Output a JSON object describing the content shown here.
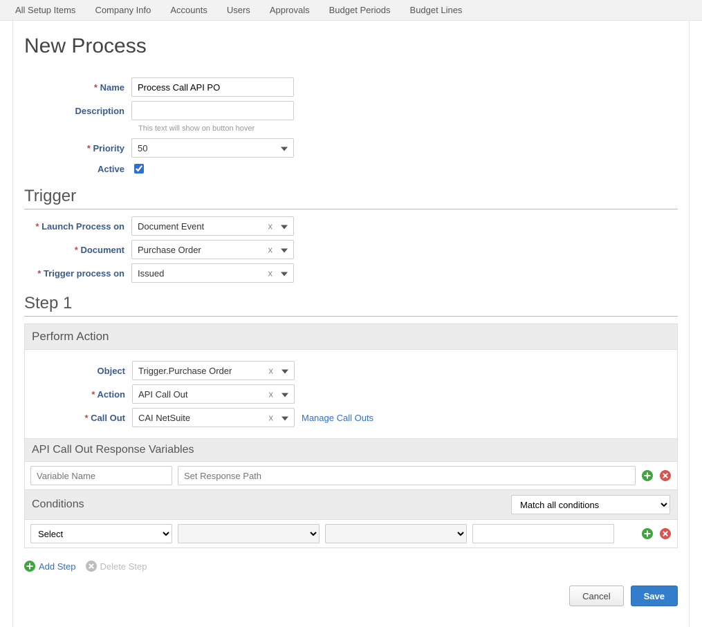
{
  "topnav": {
    "items": [
      "All Setup Items",
      "Company Info",
      "Accounts",
      "Users",
      "Approvals",
      "Budget Periods",
      "Budget Lines"
    ]
  },
  "page": {
    "title": "New Process"
  },
  "form": {
    "name": {
      "label": "Name",
      "value": "Process Call API PO"
    },
    "description": {
      "label": "Description",
      "value": "",
      "hint": "This text will show on button hover"
    },
    "priority": {
      "label": "Priority",
      "value": "50"
    },
    "active": {
      "label": "Active",
      "checked": true
    }
  },
  "trigger": {
    "title": "Trigger",
    "launch_on": {
      "label": "Launch Process on",
      "value": "Document Event"
    },
    "document": {
      "label": "Document",
      "value": "Purchase Order"
    },
    "trigger_on": {
      "label": "Trigger process on",
      "value": "Issued"
    }
  },
  "step1": {
    "title": "Step 1",
    "perform_action_header": "Perform Action",
    "object": {
      "label": "Object",
      "value": "Trigger.Purchase Order"
    },
    "action": {
      "label": "Action",
      "value": "API Call Out"
    },
    "callout": {
      "label": "Call Out",
      "value": "CAI NetSuite"
    },
    "manage_callouts": "Manage Call Outs",
    "response_vars_header": "API Call Out Response Variables",
    "var_name_placeholder": "Variable Name",
    "var_path_placeholder": "Set Response Path",
    "conditions_header": "Conditions",
    "match_mode": "Match all conditions",
    "cond_select_placeholder": "Select"
  },
  "footer": {
    "add_step": "Add Step",
    "delete_step": "Delete Step"
  },
  "buttons": {
    "cancel": "Cancel",
    "save": "Save"
  }
}
